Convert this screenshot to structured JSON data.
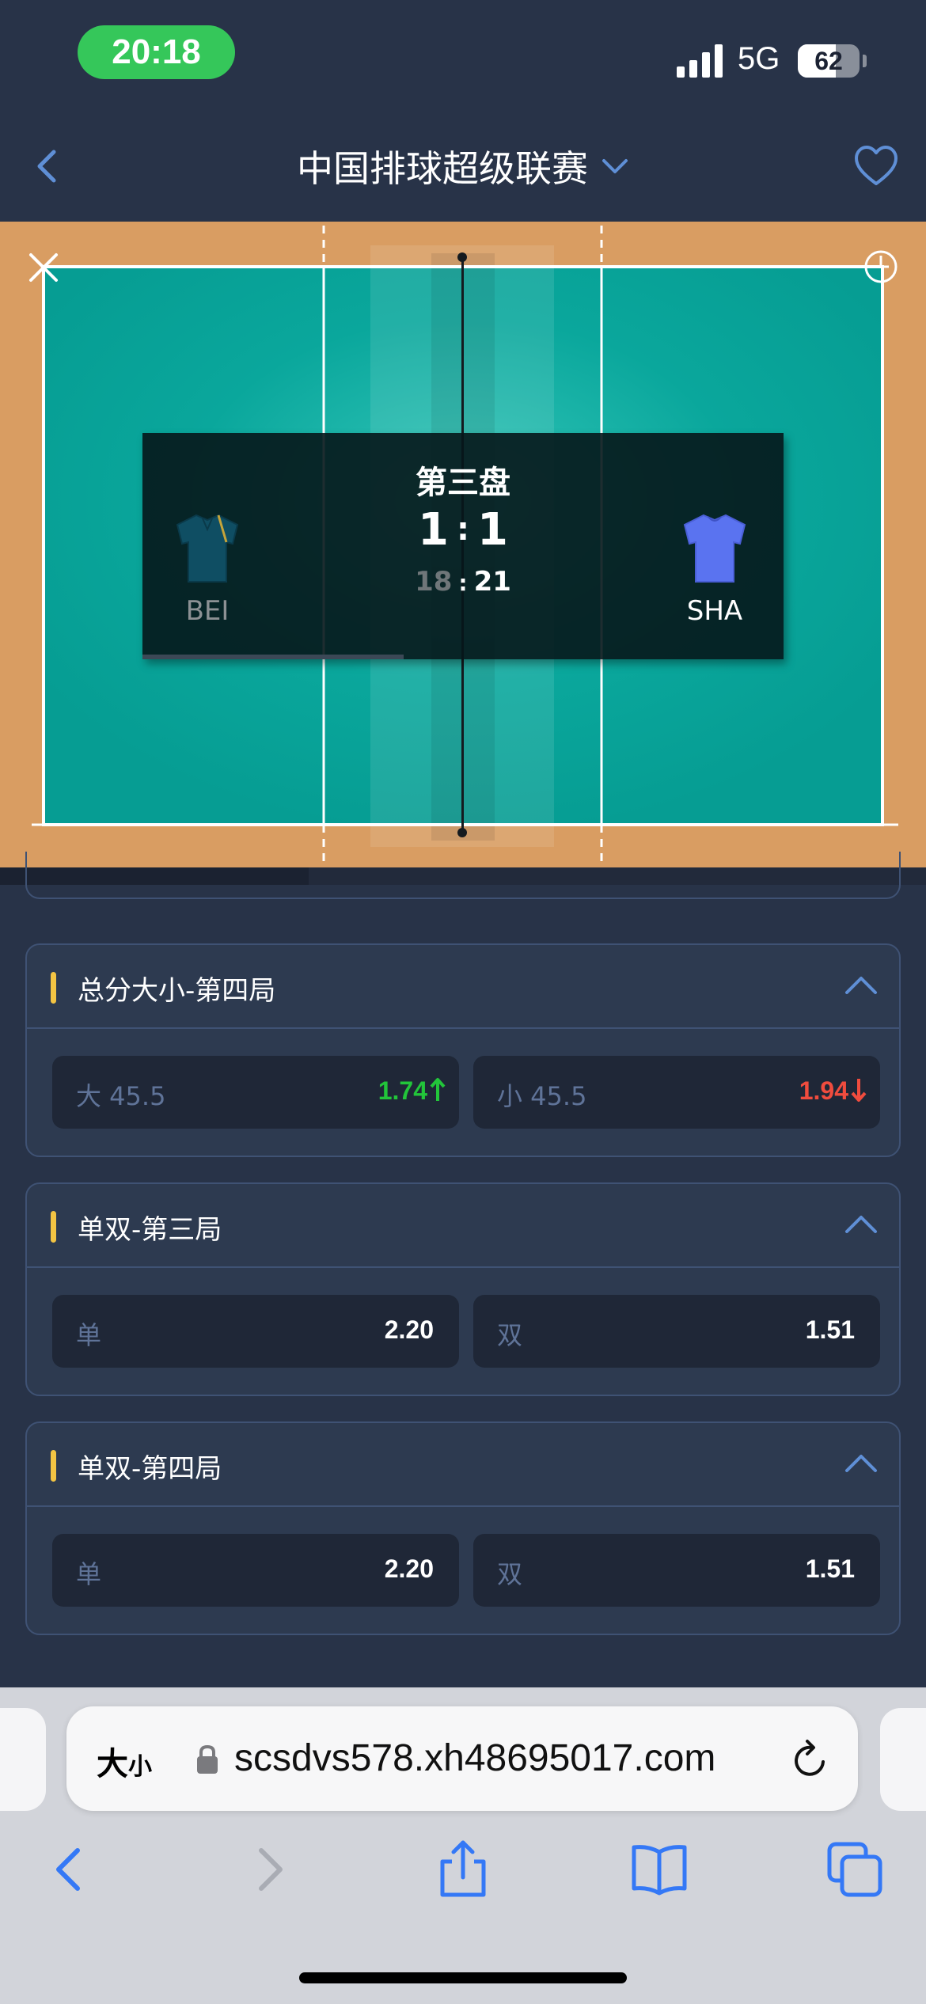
{
  "status_bar": {
    "time": "20:18",
    "network": "5G",
    "battery_level": "62",
    "battery_fraction": 0.62
  },
  "header": {
    "title": "中国排球超级联赛",
    "icons": [
      "chevron-left-icon",
      "chevron-down-icon",
      "heart-icon"
    ]
  },
  "match": {
    "set_label": "第三盘",
    "home_sets": "1",
    "away_sets": "1",
    "sets_separator": ":",
    "home_points": "18",
    "away_points": "21",
    "points_separator": ":",
    "home_team": "BEI",
    "away_team": "SHA",
    "colors": {
      "court_surface": "#0aa79c",
      "court_outer": "#d99d62",
      "home_jersey": "#0f4e63",
      "away_jersey": "#5a73f0"
    }
  },
  "markets": [
    {
      "title": "总分大小-第四局",
      "options": [
        {
          "label": "大 45.5",
          "odds": "1.74",
          "trend": "up"
        },
        {
          "label": "小 45.5",
          "odds": "1.94",
          "trend": "down"
        }
      ]
    },
    {
      "title": "单双-第三局",
      "options": [
        {
          "label": "单",
          "odds": "2.20",
          "trend": "none"
        },
        {
          "label": "双",
          "odds": "1.51",
          "trend": "none"
        }
      ]
    },
    {
      "title": "单双-第四局",
      "options": [
        {
          "label": "单",
          "odds": "2.20",
          "trend": "none"
        },
        {
          "label": "双",
          "odds": "1.51",
          "trend": "none"
        }
      ]
    }
  ],
  "browser": {
    "text_size_big": "大",
    "text_size_small": "小",
    "url": "scsdvs578.xh48695017.com",
    "toolbar": [
      "back-icon",
      "forward-icon",
      "share-icon",
      "bookmarks-icon",
      "tabs-icon"
    ]
  },
  "colors": {
    "page_bg": "#283348",
    "card_bg": "#2d3a50",
    "card_border": "#3f5274",
    "accent": "#f3c443",
    "odds_up": "#22c53a",
    "odds_down": "#f04c3e",
    "ios_blue": "#3478f6"
  }
}
